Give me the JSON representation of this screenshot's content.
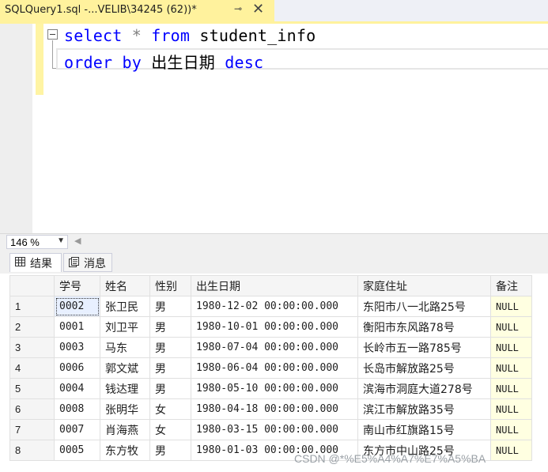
{
  "tab": {
    "title": "SQLQuery1.sql -...VELIB\\34245 (62))*",
    "pin_icon": "pin-icon",
    "close_icon": "close-icon"
  },
  "editor": {
    "line1": {
      "kw1": "select",
      "op": "*",
      "kw2": "from",
      "ident": "student_info"
    },
    "line2": {
      "kw1": "order",
      "kw2": "by",
      "ident": "出生日期",
      "kw3": "desc"
    }
  },
  "zoom": {
    "value": "146 %"
  },
  "result_tabs": [
    {
      "label": "结果",
      "icon": "grid-icon"
    },
    {
      "label": "消息",
      "icon": "messages-icon"
    }
  ],
  "grid": {
    "columns": [
      "学号",
      "姓名",
      "性别",
      "出生日期",
      "家庭住址",
      "备注"
    ],
    "rows": [
      [
        "1",
        "0002",
        "张卫民",
        "男",
        "1980-12-02 00:00:00.000",
        "东阳市八一北路25号",
        "NULL"
      ],
      [
        "2",
        "0001",
        "刘卫平",
        "男",
        "1980-10-01 00:00:00.000",
        "衡阳市东风路78号",
        "NULL"
      ],
      [
        "3",
        "0003",
        "马东",
        "男",
        "1980-07-04 00:00:00.000",
        "长岭市五一路785号",
        "NULL"
      ],
      [
        "4",
        "0006",
        "郭文斌",
        "男",
        "1980-06-04 00:00:00.000",
        "长岛市解放路25号",
        "NULL"
      ],
      [
        "5",
        "0004",
        "钱达理",
        "男",
        "1980-05-10 00:00:00.000",
        "滨海市洞庭大道278号",
        "NULL"
      ],
      [
        "6",
        "0008",
        "张明华",
        "女",
        "1980-04-18 00:00:00.000",
        "滨江市解放路35号",
        "NULL"
      ],
      [
        "7",
        "0007",
        "肖海燕",
        "女",
        "1980-03-15 00:00:00.000",
        "南山市红旗路15号",
        "NULL"
      ],
      [
        "8",
        "0005",
        "东方牧",
        "男",
        "1980-01-03 00:00:00.000",
        "东方市中山路25号",
        "NULL"
      ]
    ]
  },
  "watermark": "CSDN @*%E5%A4%A7%E7%A5%BA",
  "colors": {
    "tab_active": "#fff29d",
    "keyword": "#0000ff",
    "operator": "#808080",
    "null_cell": "#ffffe1"
  }
}
